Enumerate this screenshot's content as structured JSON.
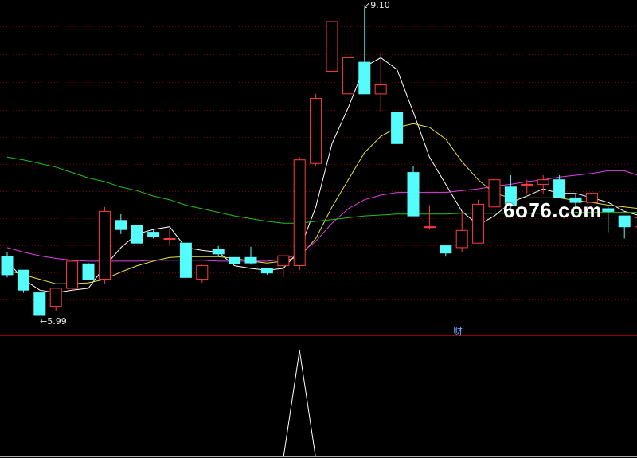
{
  "chart_data": {
    "type": "candlestick",
    "ylim": [
      5.4,
      9.2
    ],
    "grid": true,
    "labels": {
      "high": "9.10",
      "low": "5.99"
    },
    "candles": [
      {
        "o": 6.35,
        "h": 6.4,
        "l": 6.12,
        "c": 6.15
      },
      {
        "o": 6.2,
        "h": 6.2,
        "l": 5.95,
        "c": 5.98
      },
      {
        "o": 5.95,
        "h": 5.95,
        "l": 5.7,
        "c": 5.7
      },
      {
        "o": 5.8,
        "h": 6.0,
        "l": 5.75,
        "c": 6.0
      },
      {
        "o": 6.0,
        "h": 6.35,
        "l": 5.95,
        "c": 6.3
      },
      {
        "o": 6.27,
        "h": 6.28,
        "l": 6.1,
        "c": 6.1
      },
      {
        "o": 6.1,
        "h": 6.9,
        "l": 6.05,
        "c": 6.85
      },
      {
        "o": 6.75,
        "h": 6.82,
        "l": 6.6,
        "c": 6.65
      },
      {
        "o": 6.7,
        "h": 6.7,
        "l": 6.5,
        "c": 6.5
      },
      {
        "o": 6.62,
        "h": 6.65,
        "l": 6.55,
        "c": 6.57
      },
      {
        "o": 6.55,
        "h": 6.66,
        "l": 6.48,
        "c": 6.55
      },
      {
        "o": 6.5,
        "h": 6.5,
        "l": 6.1,
        "c": 6.12
      },
      {
        "o": 6.1,
        "h": 6.26,
        "l": 6.06,
        "c": 6.25
      },
      {
        "o": 6.43,
        "h": 6.47,
        "l": 6.35,
        "c": 6.38
      },
      {
        "o": 6.34,
        "h": 6.34,
        "l": 6.27,
        "c": 6.27
      },
      {
        "o": 6.34,
        "h": 6.46,
        "l": 6.26,
        "c": 6.28
      },
      {
        "o": 6.22,
        "h": 6.22,
        "l": 6.15,
        "c": 6.17
      },
      {
        "o": 6.25,
        "h": 6.36,
        "l": 6.12,
        "c": 6.36
      },
      {
        "o": 6.25,
        "h": 7.45,
        "l": 6.2,
        "c": 7.42
      },
      {
        "o": 7.38,
        "h": 8.15,
        "l": 7.35,
        "c": 8.1
      },
      {
        "o": 8.4,
        "h": 8.95,
        "l": 8.4,
        "c": 8.95
      },
      {
        "o": 8.15,
        "h": 8.55,
        "l": 8.15,
        "c": 8.55
      },
      {
        "o": 8.5,
        "h": 9.1,
        "l": 8.2,
        "c": 8.15
      },
      {
        "o": 8.15,
        "h": 8.6,
        "l": 7.95,
        "c": 8.25
      },
      {
        "o": 7.95,
        "h": 7.95,
        "l": 7.6,
        "c": 7.6
      },
      {
        "o": 7.28,
        "h": 7.35,
        "l": 6.8,
        "c": 6.8
      },
      {
        "o": 6.68,
        "h": 6.92,
        "l": 6.65,
        "c": 6.68
      },
      {
        "o": 6.47,
        "h": 6.47,
        "l": 6.35,
        "c": 6.39
      },
      {
        "o": 6.45,
        "h": 6.85,
        "l": 6.4,
        "c": 6.64
      },
      {
        "o": 6.5,
        "h": 6.98,
        "l": 6.5,
        "c": 6.93
      },
      {
        "o": 6.9,
        "h": 7.2,
        "l": 6.9,
        "c": 7.2
      },
      {
        "o": 7.12,
        "h": 7.25,
        "l": 6.88,
        "c": 6.92
      },
      {
        "o": 7.15,
        "h": 7.2,
        "l": 7.05,
        "c": 7.15
      },
      {
        "o": 7.15,
        "h": 7.25,
        "l": 7.05,
        "c": 7.2
      },
      {
        "o": 7.2,
        "h": 7.25,
        "l": 7.0,
        "c": 7.0
      },
      {
        "o": 7.0,
        "h": 7.05,
        "l": 6.9,
        "c": 6.95
      },
      {
        "o": 6.95,
        "h": 7.05,
        "l": 6.9,
        "c": 7.05
      },
      {
        "o": 6.88,
        "h": 6.9,
        "l": 6.62,
        "c": 6.85
      },
      {
        "o": 6.8,
        "h": 6.8,
        "l": 6.55,
        "c": 6.68
      },
      {
        "o": 6.68,
        "h": 6.78,
        "l": 6.6,
        "c": 6.78
      }
    ],
    "moving_averages": [
      {
        "color": "#ffffff",
        "values": [
          6.3,
          6.1,
          5.98,
          5.95,
          5.98,
          6.0,
          6.24,
          6.45,
          6.6,
          6.65,
          6.68,
          6.45,
          6.42,
          6.4,
          6.25,
          6.22,
          6.2,
          6.22,
          6.42,
          6.9,
          7.6,
          8.0,
          8.45,
          8.55,
          8.42,
          7.95,
          7.45,
          7.15,
          6.85,
          6.7,
          6.8,
          6.95,
          7.02,
          7.1,
          7.05,
          7.05,
          7.0,
          6.95,
          6.85,
          6.8
        ]
      },
      {
        "color": "#e8e040",
        "values": [
          6.2,
          6.15,
          6.1,
          6.05,
          6.05,
          6.06,
          6.1,
          6.18,
          6.25,
          6.3,
          6.34,
          6.35,
          6.35,
          6.35,
          6.33,
          6.3,
          6.28,
          6.3,
          6.35,
          6.55,
          6.9,
          7.2,
          7.5,
          7.68,
          7.78,
          7.82,
          7.78,
          7.65,
          7.4,
          7.2,
          7.05,
          7.0,
          7.0,
          7.0,
          7.0,
          6.97,
          6.95,
          6.92,
          6.9,
          6.88
        ]
      },
      {
        "color": "#e040e0",
        "values": [
          6.45,
          6.4,
          6.36,
          6.33,
          6.31,
          6.3,
          6.3,
          6.3,
          6.3,
          6.31,
          6.31,
          6.31,
          6.31,
          6.3,
          6.3,
          6.3,
          6.3,
          6.32,
          6.38,
          6.52,
          6.72,
          6.88,
          6.98,
          7.03,
          7.06,
          7.06,
          7.06,
          7.06,
          7.08,
          7.1,
          7.13,
          7.15,
          7.18,
          7.2,
          7.23,
          7.25,
          7.27,
          7.3,
          7.3,
          7.24
        ]
      },
      {
        "color": "#20c020",
        "values": [
          7.45,
          7.42,
          7.38,
          7.34,
          7.28,
          7.22,
          7.18,
          7.12,
          7.08,
          7.02,
          6.98,
          6.92,
          6.88,
          6.84,
          6.8,
          6.77,
          6.74,
          6.72,
          6.72,
          6.74,
          6.76,
          6.78,
          6.8,
          6.81,
          6.82,
          6.82,
          6.82,
          6.82,
          6.83,
          6.83,
          6.83,
          6.83,
          6.83,
          6.83,
          6.83,
          6.84,
          6.84,
          6.84,
          6.84,
          6.84
        ]
      }
    ],
    "indicator": {
      "ylim": [
        0,
        1
      ],
      "values": [
        0,
        0,
        0,
        0,
        0,
        0,
        0,
        0,
        0,
        0,
        0,
        0,
        0,
        0,
        0,
        0,
        0,
        0,
        1,
        0,
        0,
        0,
        0,
        0,
        0,
        0,
        0,
        0,
        0,
        0,
        0,
        0,
        0,
        0,
        0,
        0,
        0,
        0,
        0,
        0
      ],
      "color": "#ffffff"
    },
    "annotation": "财"
  },
  "watermark": "6o76.com",
  "colors": {
    "up": "#ff3c3c",
    "down": "#54fcfc",
    "grid": "#7a0000",
    "divider": "#8b0000",
    "axis_text": "#e8e8e8",
    "background": "#000000"
  }
}
